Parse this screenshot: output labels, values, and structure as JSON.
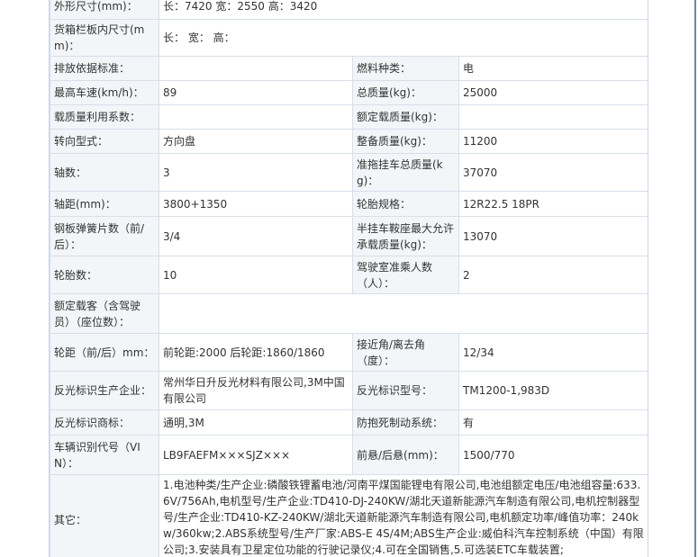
{
  "rows": [
    {
      "label": "外形尺寸(mm)：",
      "value": "长：7420 宽：2550 高：3420"
    },
    {
      "label": "货箱栏板内尺寸(mm)：",
      "value": "长：  宽：  高："
    },
    {
      "label": "排放依据标准：",
      "value": "",
      "label2": "燃料种类：",
      "value2": "电"
    },
    {
      "label": "最高车速(km/h)：",
      "value": "89",
      "label2": "总质量(kg)：",
      "value2": "25000"
    },
    {
      "label": "载质量利用系数：",
      "value": "",
      "label2": "额定载质量(kg)：",
      "value2": ""
    },
    {
      "label": "转向型式：",
      "value": "方向盘",
      "label2": "整备质量(kg)：",
      "value2": "11200"
    },
    {
      "label": "轴数：",
      "value": "3",
      "label2": "准拖挂车总质量(kg)：",
      "value2": "37070"
    },
    {
      "label": "轴距(mm)：",
      "value": "3800+1350",
      "label2": "轮胎规格：",
      "value2": "12R22.5 18PR"
    },
    {
      "label": "钢板弹簧片数（前/后）：",
      "value": "3/4",
      "label2": "半挂车鞍座最大允许承载质量(kg)：",
      "value2": "13070"
    },
    {
      "label": "轮胎数：",
      "value": "10",
      "label2": "驾驶室准乘人数（人）：",
      "value2": "2"
    },
    {
      "label": "额定载客（含驾驶员）（座位数）：",
      "value": ""
    },
    {
      "label": "轮距（前/后）mm：",
      "value": "前轮距:2000 后轮距:1860/1860",
      "label2": "接近角/离去角（度）：",
      "value2": "12/34"
    },
    {
      "label": "反光标识生产企业：",
      "value": "常州华日升反光材料有限公司,3M中国有限公司",
      "label2": "反光标识型号：",
      "value2": "TM1200-1,983D"
    },
    {
      "label": "反光标识商标：",
      "value": "通明,3M",
      "label2": "防抱死制动系统：",
      "value2": "有"
    },
    {
      "label": "车辆识别代号（VIN）：",
      "value": "LB9FAEFM×××SJZ×××",
      "label2": "前悬/后悬(mm)：",
      "value2": "1500/770"
    },
    {
      "label": "其它：",
      "value": "1.电池种类/生产企业:磷酸铁锂蓄电池/河南平煤国能锂电有限公司,电池组额定电压/电池组容量:633.6V/756Ah,电机型号/生产企业:TD410-DJ-240KW/湖北天道新能源汽车制造有限公司,电机控制器型号/生产企业:TD410-KZ-240KW/湖北天道新能源汽车制造有限公司,电机额定功率/峰值功率：240kw/360kw;2.ABS系统型号/生产厂家:ABS-E 4S/4M;ABS生产企业:威伯科汽车控制系统（中国）有限公司;3.安装具有卫星定位功能的行驶记录仪;4.可在全国销售,5.可选装ETC车载装置;"
    }
  ]
}
